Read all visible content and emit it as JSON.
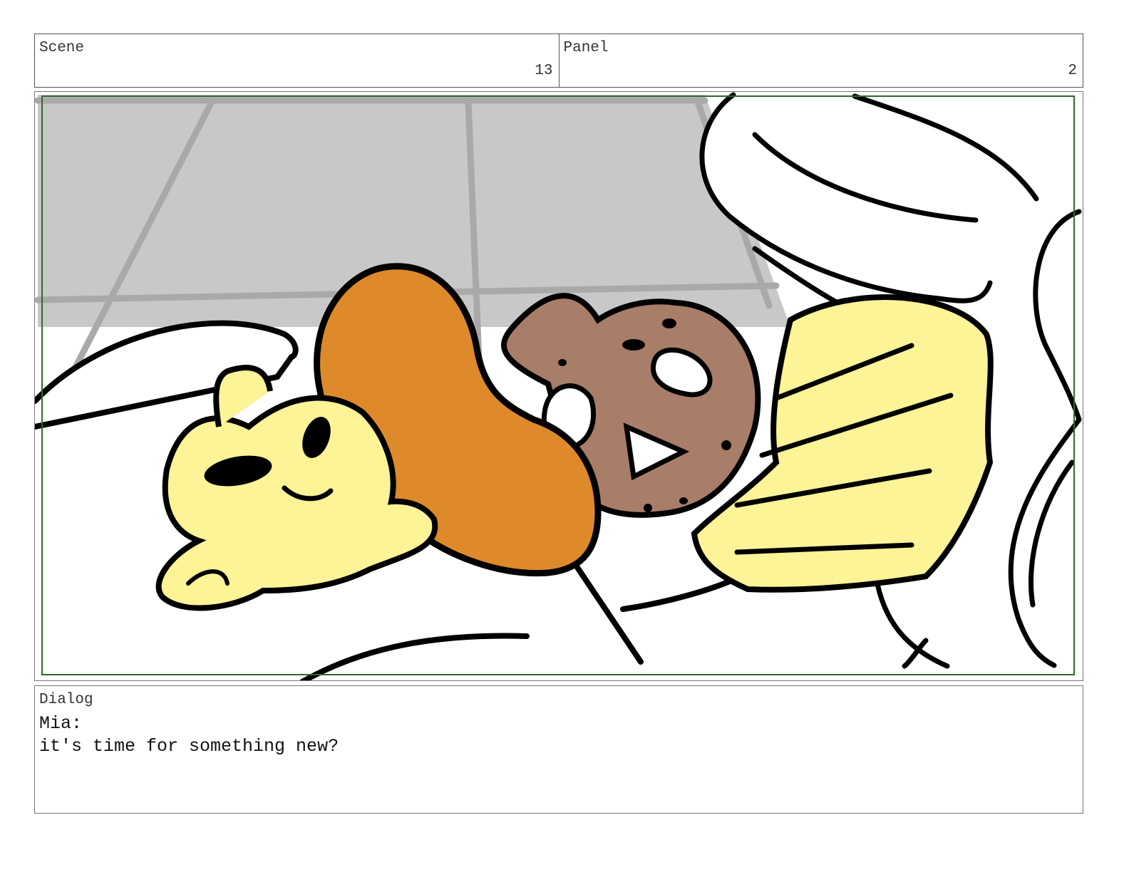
{
  "header": {
    "scene_label": "Scene",
    "scene_number": "13",
    "panel_label": "Panel",
    "panel_number": "2"
  },
  "dialog": {
    "label": "Dialog",
    "speaker": "Mia:",
    "line": "it's time for something new?"
  },
  "colors": {
    "floor": "#c8c8c8",
    "skin": "#fdf397",
    "hair": "#de8a2b",
    "pretzel": "#a87e69",
    "frame_guide": "#2e6b2e",
    "ink": "#000000"
  }
}
